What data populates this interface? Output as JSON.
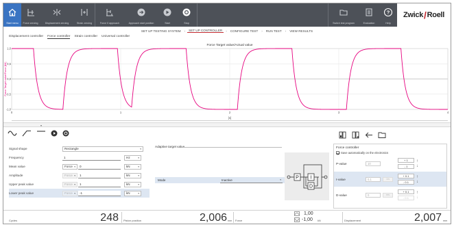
{
  "toolbar": {
    "buttons": [
      {
        "label": "Start menu",
        "icon": "home-icon",
        "active": true
      },
      {
        "label": "Force zeroing",
        "icon": "force-zeroing-icon"
      },
      {
        "label": "Displacement zeroing",
        "icon": "displacement-zeroing-icon"
      },
      {
        "label": "Strain zeroing",
        "icon": "strain-zeroing-icon"
      },
      {
        "label": "Force 0 approach",
        "icon": "force-approach-icon"
      },
      {
        "label": "Approach start position",
        "icon": "approach-start-icon"
      },
      {
        "label": "Start",
        "icon": "play-icon"
      },
      {
        "label": "Stop",
        "icon": "stop-icon"
      }
    ],
    "right_buttons": [
      {
        "label": "Switch test program",
        "icon": "folder-icon"
      },
      {
        "label": "Evaluation",
        "icon": "evaluation-icon"
      },
      {
        "label": "Help",
        "icon": "help-icon"
      }
    ],
    "logo_left": "Zwick",
    "logo_right": "Roell"
  },
  "breadcrumb": [
    "SET UP TESTING SYSTEM",
    "SET UP CONTROLLER",
    "CONFIGURE TEST",
    "RUN TEST",
    "VIEW RESULTS"
  ],
  "subtabs": [
    "Displacement controller",
    "Force controller",
    "Strain controller",
    "Universal controller"
  ],
  "chart_data": {
    "type": "line",
    "title": "Force Target value/Actual value",
    "xlabel": "[s]",
    "ylabel": "Force Target value/Force [kN]",
    "xlim": [
      0,
      4
    ],
    "ylim": [
      -1.0,
      1.0
    ],
    "x_ticks": [
      "0",
      "1",
      "2",
      "3",
      "4"
    ],
    "y_ticks": [
      "1,0",
      "0,5",
      "0,0",
      "-0,5",
      "-1,0"
    ],
    "grid": true,
    "series": [
      {
        "type": "square-wave",
        "color": "#e6007e",
        "high": 1.0,
        "low": -1.0,
        "rise_times": [
          -0.37,
          0.47,
          1.1,
          2.07,
          3.07,
          4.07
        ],
        "fall_times": [
          0.2,
          0.97,
          1.6,
          2.57,
          3.57
        ]
      }
    ]
  },
  "signal": {
    "shape_label": "Signal shape",
    "shape_value": "Rectangle",
    "rows": [
      {
        "label": "Frequency",
        "ctrl": "",
        "value": "1",
        "unit": "Hz"
      },
      {
        "label": "Mean value",
        "ctrl": "Force",
        "value": "0",
        "unit": "kN"
      },
      {
        "label": "Amplitude",
        "ctrl": "Force",
        "value": "1",
        "unit": "kN"
      },
      {
        "label": "Upper peak value",
        "ctrl": "Force",
        "value": "1",
        "unit": "kN"
      },
      {
        "label": "Lower peak value",
        "ctrl": "Force",
        "value": "-1",
        "unit": "kN"
      }
    ]
  },
  "adaptive": {
    "title": "Adaptive target value",
    "mode_label": "Mode",
    "mode_value": "Inactive"
  },
  "pid_diagram": {
    "p": "P",
    "i": "I",
    "d": "D"
  },
  "controller": {
    "title": "Force controller",
    "save_label": "Save automatically on the electronics",
    "rows": [
      {
        "label": "P-value",
        "value": "10",
        "step_up": "+ 1",
        "step_down": "- 1"
      },
      {
        "label": "I-value",
        "value": "0,1",
        "unit": "1/s",
        "step_up": "+ 0.1",
        "step_down": "- 0.1"
      },
      {
        "label": "D-value",
        "value": "0",
        "unit": "ms",
        "step_up": "+ 0.1",
        "step_down": "- 0.1"
      }
    ]
  },
  "status": {
    "cycles_label": "Cycles",
    "cycles_value": "248",
    "piston_label": "Piston position",
    "piston_value": "2,006",
    "piston_unit": "mm",
    "force_label": "Force",
    "force_max": "1,00",
    "force_min": "-1,00",
    "force_unit": "kN",
    "disp_label": "Displacement",
    "disp_value": "2,007",
    "disp_unit": "mm"
  }
}
